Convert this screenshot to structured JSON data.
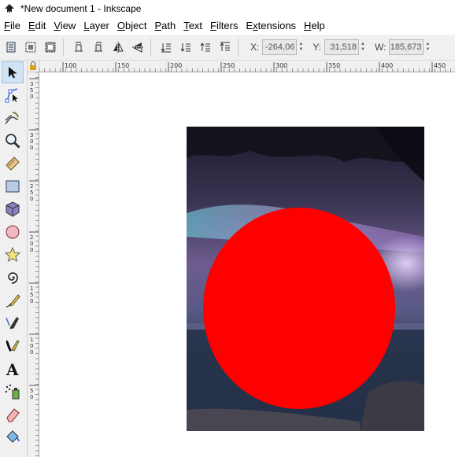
{
  "window": {
    "title": "*New document 1 - Inkscape"
  },
  "menu": {
    "file": {
      "label": "File",
      "accel": "F"
    },
    "edit": {
      "label": "Edit",
      "accel": "E"
    },
    "view": {
      "label": "View",
      "accel": "V"
    },
    "layer": {
      "label": "Layer",
      "accel": "L"
    },
    "object": {
      "label": "Object",
      "accel": "O"
    },
    "path": {
      "label": "Path",
      "accel": "P"
    },
    "text": {
      "label": "Text",
      "accel": "T"
    },
    "filters": {
      "label": "Filters",
      "accel": "F"
    },
    "extensions": {
      "label": "Extensions",
      "accel": "x"
    },
    "help": {
      "label": "Help",
      "accel": "H"
    }
  },
  "toolbar": {
    "x_label": "X:",
    "x_value": "-264,06",
    "y_label": "Y:",
    "y_value": "31,518",
    "w_label": "W:",
    "w_value": "185,673"
  },
  "hruler": {
    "labels": [
      "100",
      "150",
      "200",
      "250",
      "300",
      "350",
      "400",
      "450"
    ]
  },
  "vruler": {
    "labels": [
      "350",
      "300",
      "250",
      "200",
      "150",
      "100",
      "50"
    ]
  },
  "colors": {
    "circle_fill": "#ff0000",
    "toolbar_bg": "#f0f0f0",
    "active_tool": "#cfe3f5"
  },
  "tools": [
    "selector-tool",
    "node-tool",
    "tweak-tool",
    "zoom-tool",
    "measure-tool",
    "rectangle-tool",
    "3d-box-tool",
    "ellipse-tool",
    "star-tool",
    "spiral-tool",
    "pencil-tool",
    "pen-tool",
    "calligraphy-tool",
    "text-tool",
    "spray-tool",
    "eraser-tool",
    "paint-bucket-tool"
  ]
}
